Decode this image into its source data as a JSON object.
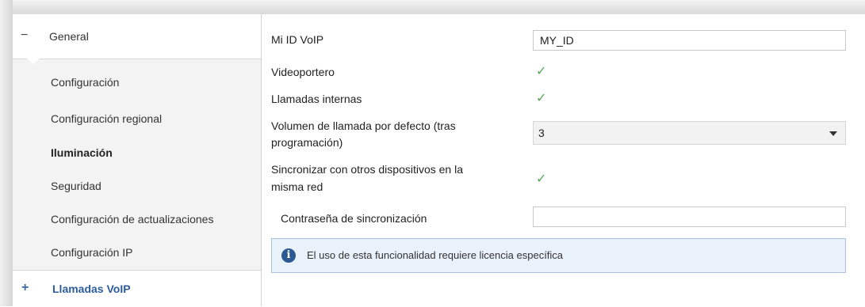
{
  "sidebar": {
    "header": {
      "sign": "−",
      "label": "General"
    },
    "items": [
      {
        "label": "Configuración"
      },
      {
        "label": "Configuración regional"
      },
      {
        "label": "Iluminación"
      },
      {
        "label": "Seguridad"
      },
      {
        "label": "Configuración de actualizaciones"
      },
      {
        "label": "Configuración IP"
      }
    ],
    "active": {
      "sign": "+",
      "label": "Llamadas VoIP"
    }
  },
  "form": {
    "voip_id": {
      "label": "Mi ID VoIP",
      "value": "MY_ID"
    },
    "videoportero": {
      "label": "Videoportero",
      "checked": true
    },
    "internal_calls": {
      "label": "Llamadas internas",
      "checked": true
    },
    "volume": {
      "label_line1": "Volumen de llamada por defecto (tras",
      "label_line2": "programación)",
      "value": "3"
    },
    "sync": {
      "label_line1": "Sincronizar con otros dispositivos en la",
      "label_line2": "misma red",
      "checked": true
    },
    "sync_password": {
      "label": "Contraseña de sincronización",
      "value": ""
    }
  },
  "info": {
    "icon": "info-icon",
    "text": "El uso de esta funcionalidad requiere licencia específica"
  },
  "colors": {
    "accent": "#2d5c9c",
    "check": "#5aa55a",
    "info_bg": "#e9f1fa",
    "info_border": "#a9c3df"
  }
}
